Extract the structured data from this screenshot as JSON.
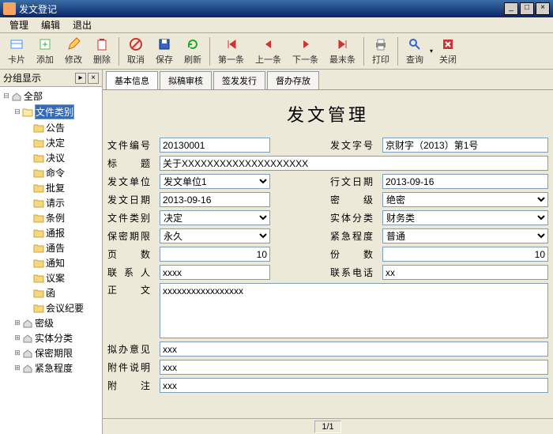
{
  "window": {
    "title": "发文登记"
  },
  "menu": [
    "管理",
    "编辑",
    "退出"
  ],
  "toolbar": [
    {
      "label": "卡片",
      "icon": "card"
    },
    {
      "label": "添加",
      "icon": "add"
    },
    {
      "label": "修改",
      "icon": "edit"
    },
    {
      "label": "删除",
      "icon": "del"
    },
    {
      "label": "取消",
      "icon": "cancel"
    },
    {
      "label": "保存",
      "icon": "save"
    },
    {
      "label": "刷新",
      "icon": "refresh"
    },
    {
      "label": "第一条",
      "icon": "first"
    },
    {
      "label": "上一条",
      "icon": "prev"
    },
    {
      "label": "下一条",
      "icon": "next"
    },
    {
      "label": "最末条",
      "icon": "last"
    },
    {
      "label": "打印",
      "icon": "print"
    },
    {
      "label": "查询",
      "icon": "search"
    },
    {
      "label": "关闭",
      "icon": "close"
    }
  ],
  "sidebar": {
    "header": "分组显示",
    "root": "全部",
    "cat_label": "文件类别",
    "cats": [
      "公告",
      "决定",
      "决议",
      "命令",
      "批复",
      "请示",
      "条例",
      "通报",
      "通告",
      "通知",
      "议案",
      "函",
      "会议纪要"
    ],
    "groups": [
      "密级",
      "实体分类",
      "保密期限",
      "紧急程度"
    ]
  },
  "tabs": [
    "基本信息",
    "拟稿审核",
    "签发发行",
    "督办存放"
  ],
  "page_title": "发文管理",
  "form": {
    "file_no_label": "文件编号",
    "file_no": "20130001",
    "doc_char_label": "发文字号",
    "doc_char": "京财字（2013）第1号",
    "title_label": "标　题",
    "title": "关于XXXXXXXXXXXXXXXXXXXX",
    "send_unit_label": "发文单位",
    "send_unit": "发文单位1",
    "action_date_label": "行文日期",
    "action_date": "2013-09-16",
    "send_date_label": "发文日期",
    "send_date": "2013-09-16",
    "secret_label": "密　级",
    "secret": "绝密",
    "doc_type_label": "文件类别",
    "doc_type": "决定",
    "entity_label": "实体分类",
    "entity": "财务类",
    "period_label": "保密期限",
    "period": "永久",
    "urgency_label": "紧急程度",
    "urgency": "普通",
    "pages_label": "页　数",
    "pages": "10",
    "copies_label": "份　数",
    "copies": "10",
    "contact_label": "联 系 人",
    "contact": "xxxx",
    "phone_label": "联系电话",
    "phone": "xx",
    "body_label": "正　文",
    "body": "xxxxxxxxxxxxxxxxx",
    "opinion_label": "拟办意见",
    "opinion": "xxx",
    "attach_label": "附件说明",
    "attach": "xxx",
    "remark_label": "附　注",
    "remark": "xxx"
  },
  "status": {
    "page": "1/1"
  }
}
